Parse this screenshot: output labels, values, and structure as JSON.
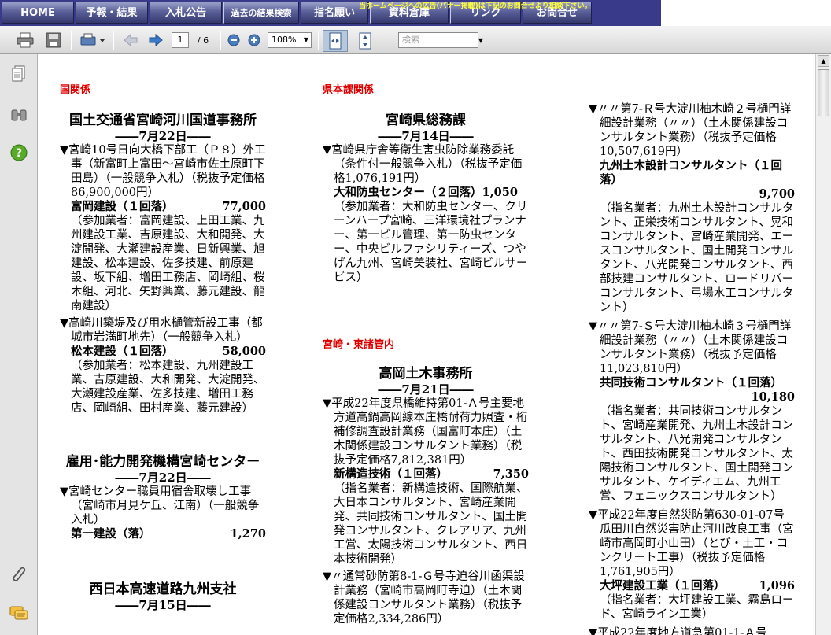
{
  "nav": {
    "items": [
      "HOME",
      "予報・結果",
      "入札公告",
      "過去の結果検索",
      "指名願い",
      "資料倉庫",
      "リンク",
      "お問合せ"
    ],
    "banner": "当ホームページへの広告(バナー掲載)は下記のお問合せより相談下さい。"
  },
  "toolbar": {
    "page_current": "1",
    "page_total": "/ 6",
    "zoom": "108%",
    "search_placeholder": "検索"
  },
  "doc": {
    "col1": {
      "section": "国関係",
      "office1": {
        "name": "国土交通省宮崎河川国道事務所",
        "date": "――7月22日――",
        "item1": {
          "desc": "▼宮崎10号日向大橋下部工（Ｐ８）外工事（新富町上富田～宮崎市佐土原町下田島）（一般競争入札）（税抜予定価格86,900,000円）",
          "winner": "富岡建設（１回落）",
          "value": "77,000",
          "participants": "（参加業者：富岡建設、上田工業、九州建設工業、吉原建設、大和開発、大淀開発、大瀬建設産業、日新興業、旭建設、松本建設、佐多技建、前原建設、坂下組、増田工務店、岡崎組、桜木組、河北、矢野興業、藤元建設、龍南建設）"
        },
        "item2": {
          "desc": "▼高崎川築堤及び用水樋管新設工事（都城市岩満町地先）（一般競争入札）",
          "winner": "松本建設（１回落）",
          "value": "58,000",
          "participants": "（参加業者：松本建設、九州建設工業、吉原建設、大和開発、大淀開発、大瀬建設産業、佐多技建、増田工務店、岡崎組、田村産業、藤元建設）"
        }
      },
      "office2": {
        "name": "雇用･能力開発機構宮崎センター",
        "date": "――7月22日――",
        "item1": {
          "desc": "▼宮崎センター職員用宿舎取壊し工事（宮崎市月見ケ丘、江南）（一般競争入札）",
          "winner": "第一建設（落）",
          "value": "1,270"
        }
      },
      "office3": {
        "name": "西日本高速道路九州支社",
        "date": "――7月15日――"
      }
    },
    "col2": {
      "section1": "県本課関係",
      "office1": {
        "name": "宮崎県総務課",
        "date": "――7月14日――",
        "item1": {
          "desc": "▼宮崎県庁舎等衛生害虫防除業務委託（条件付一般競争入札）（税抜予定価格1,076,191円）",
          "winner": "大和防虫センター（２回落）1,050",
          "participants": "（参加業者：大和防虫センター、クリーンハープ宮崎、三洋環境社プランナー、第一ビル管理、第一防虫センター、中央ビルファシリティーズ、つやげん九州、宮崎美装社、宮崎ビルサービス）"
        }
      },
      "section2": "宮崎・東諸管内",
      "office2": {
        "name": "高岡土木事務所",
        "date": "――7月21日――",
        "item1": {
          "desc": "▼平成22年度県橋維持第01-Ａ号主要地方道高鍋高岡線本庄橋耐荷力照査・桁補修調査設計業務（国富町本庄）（土木関係建設コンサルタント業務）（税抜予定価格7,812,381円）",
          "winner": "新構造技術（１回落）",
          "value": "7,350",
          "participants": "（指名業者：新構造技術、国際航業、大日本コンサルタント、宮崎産業開発、共同技術コンサルタント、国土開発コンサルタント、クレアリア、九州工営、太陽技術コンサルタント、西日本技術開発）"
        },
        "item2": {
          "desc": "▼〃通常砂防第8-1-Ｇ号寺迫谷川函渠設計業務（宮崎市高岡町寺迫）（土木関係建設コンサルタント業務）（税抜予定価格2,334,286円）"
        }
      }
    },
    "col3": {
      "item1": {
        "desc": "▼〃〃第7-Ｒ号大淀川柚木崎２号樋門詳細設計業務（〃〃）（土木関係建設コンサルタント業務）（税抜予定価格10,507,619円）",
        "winner": "九州土木設計コンサルタント（１回落）",
        "value": "9,700",
        "participants": "（指名業者：九州土木設計コンサルタント、正栄技術コンサルタント、晃和コンサルタント、宮崎産業開発、エースコンサルタント、国土開発コンサルタント、八光開発コンサルタント、西部技建コンサルタント、ロードリバーコンサルタント、弓場水工コンサルタント）"
      },
      "item2": {
        "desc": "▼〃〃第7-Ｓ号大淀川柚木崎３号樋門詳細設計業務（〃〃）（土木関係建設コンサルタント業務）（税抜予定価格11,023,810円）",
        "winner": "共同技術コンサルタント（１回落）",
        "value": "10,180",
        "participants": "（指名業者：共同技術コンサルタント、宮崎産業開発、九州土木設計コンサルタント、八光開発コンサルタント、西田技術開発コンサルタント、太陽技術コンサルタント、国土開発コンサルタント、ケイディエム、九州工営、フェニックスコンサルタント）"
      },
      "item3": {
        "desc": "▼平成22年度自然災防第630-01-07号瓜田川自然災害防止河川改良工事（宮崎市高岡町小山田）（とび・土工・コンクリート工事）（税抜予定価格1,761,905円）",
        "winner": "大坪建設工業（１回落）",
        "value": "1,096",
        "participants": "（指名業者：大坪建設工業、霧島ロード、宮崎ライン工業）"
      },
      "item4": {
        "desc": "▼平成22年度地方道急第01-1-Ａ号"
      }
    }
  }
}
